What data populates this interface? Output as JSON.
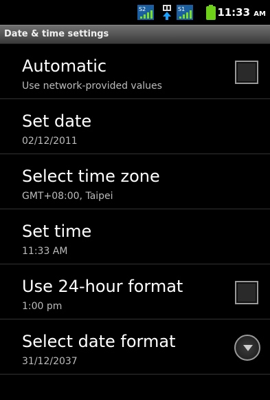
{
  "status_bar": {
    "icons": [
      "sim2-signal-icon",
      "data-arrow-icon",
      "sim1-signal-icon",
      "battery-icon"
    ],
    "sim2_label": "S2",
    "sim1_label": "S1",
    "time": "11:33",
    "ampm": "AM"
  },
  "title_bar": {
    "title": "Date & time settings"
  },
  "prefs": [
    {
      "title": "Automatic",
      "summary": "Use network-provided values",
      "widget": "checkbox",
      "checked": false
    },
    {
      "title": "Set date",
      "summary": "02/12/2011"
    },
    {
      "title": "Select time zone",
      "summary": "GMT+08:00, Taipei"
    },
    {
      "title": "Set time",
      "summary": "11:33 AM"
    },
    {
      "title": "Use 24-hour format",
      "summary": "1:00 pm",
      "widget": "checkbox",
      "checked": false
    },
    {
      "title": "Select date format",
      "summary": "31/12/2037",
      "widget": "dropdown"
    }
  ],
  "colors": {
    "background": "#000000",
    "title_bar": "#5a5a5a",
    "summary_text": "#bcbcbc"
  }
}
